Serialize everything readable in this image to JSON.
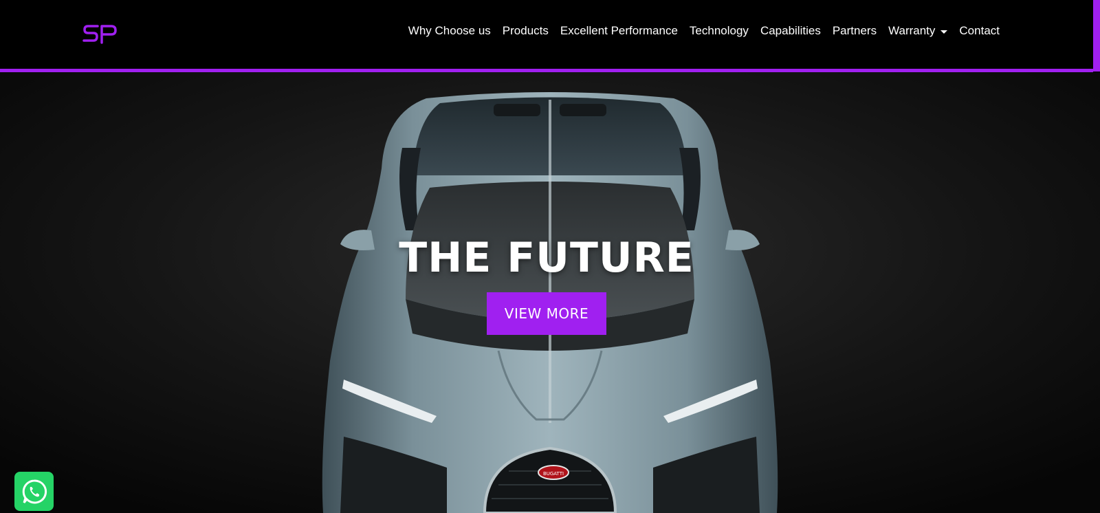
{
  "brand": {
    "logo_text": "SP",
    "accent_color": "#a020f0"
  },
  "nav": {
    "items": [
      {
        "label": "Why Choose us"
      },
      {
        "label": "Products"
      },
      {
        "label": "Excellent Performance"
      },
      {
        "label": "Technology"
      },
      {
        "label": "Capabilities"
      },
      {
        "label": "Partners"
      },
      {
        "label": "Warranty",
        "dropdown": true
      },
      {
        "label": "Contact"
      }
    ]
  },
  "hero": {
    "title": "THE FUTURE",
    "button_label": "VIEW MORE",
    "grille_badge": "BUGATTI"
  },
  "floating": {
    "whatsapp_icon": "whatsapp-icon",
    "whatsapp_color": "#25d366"
  }
}
